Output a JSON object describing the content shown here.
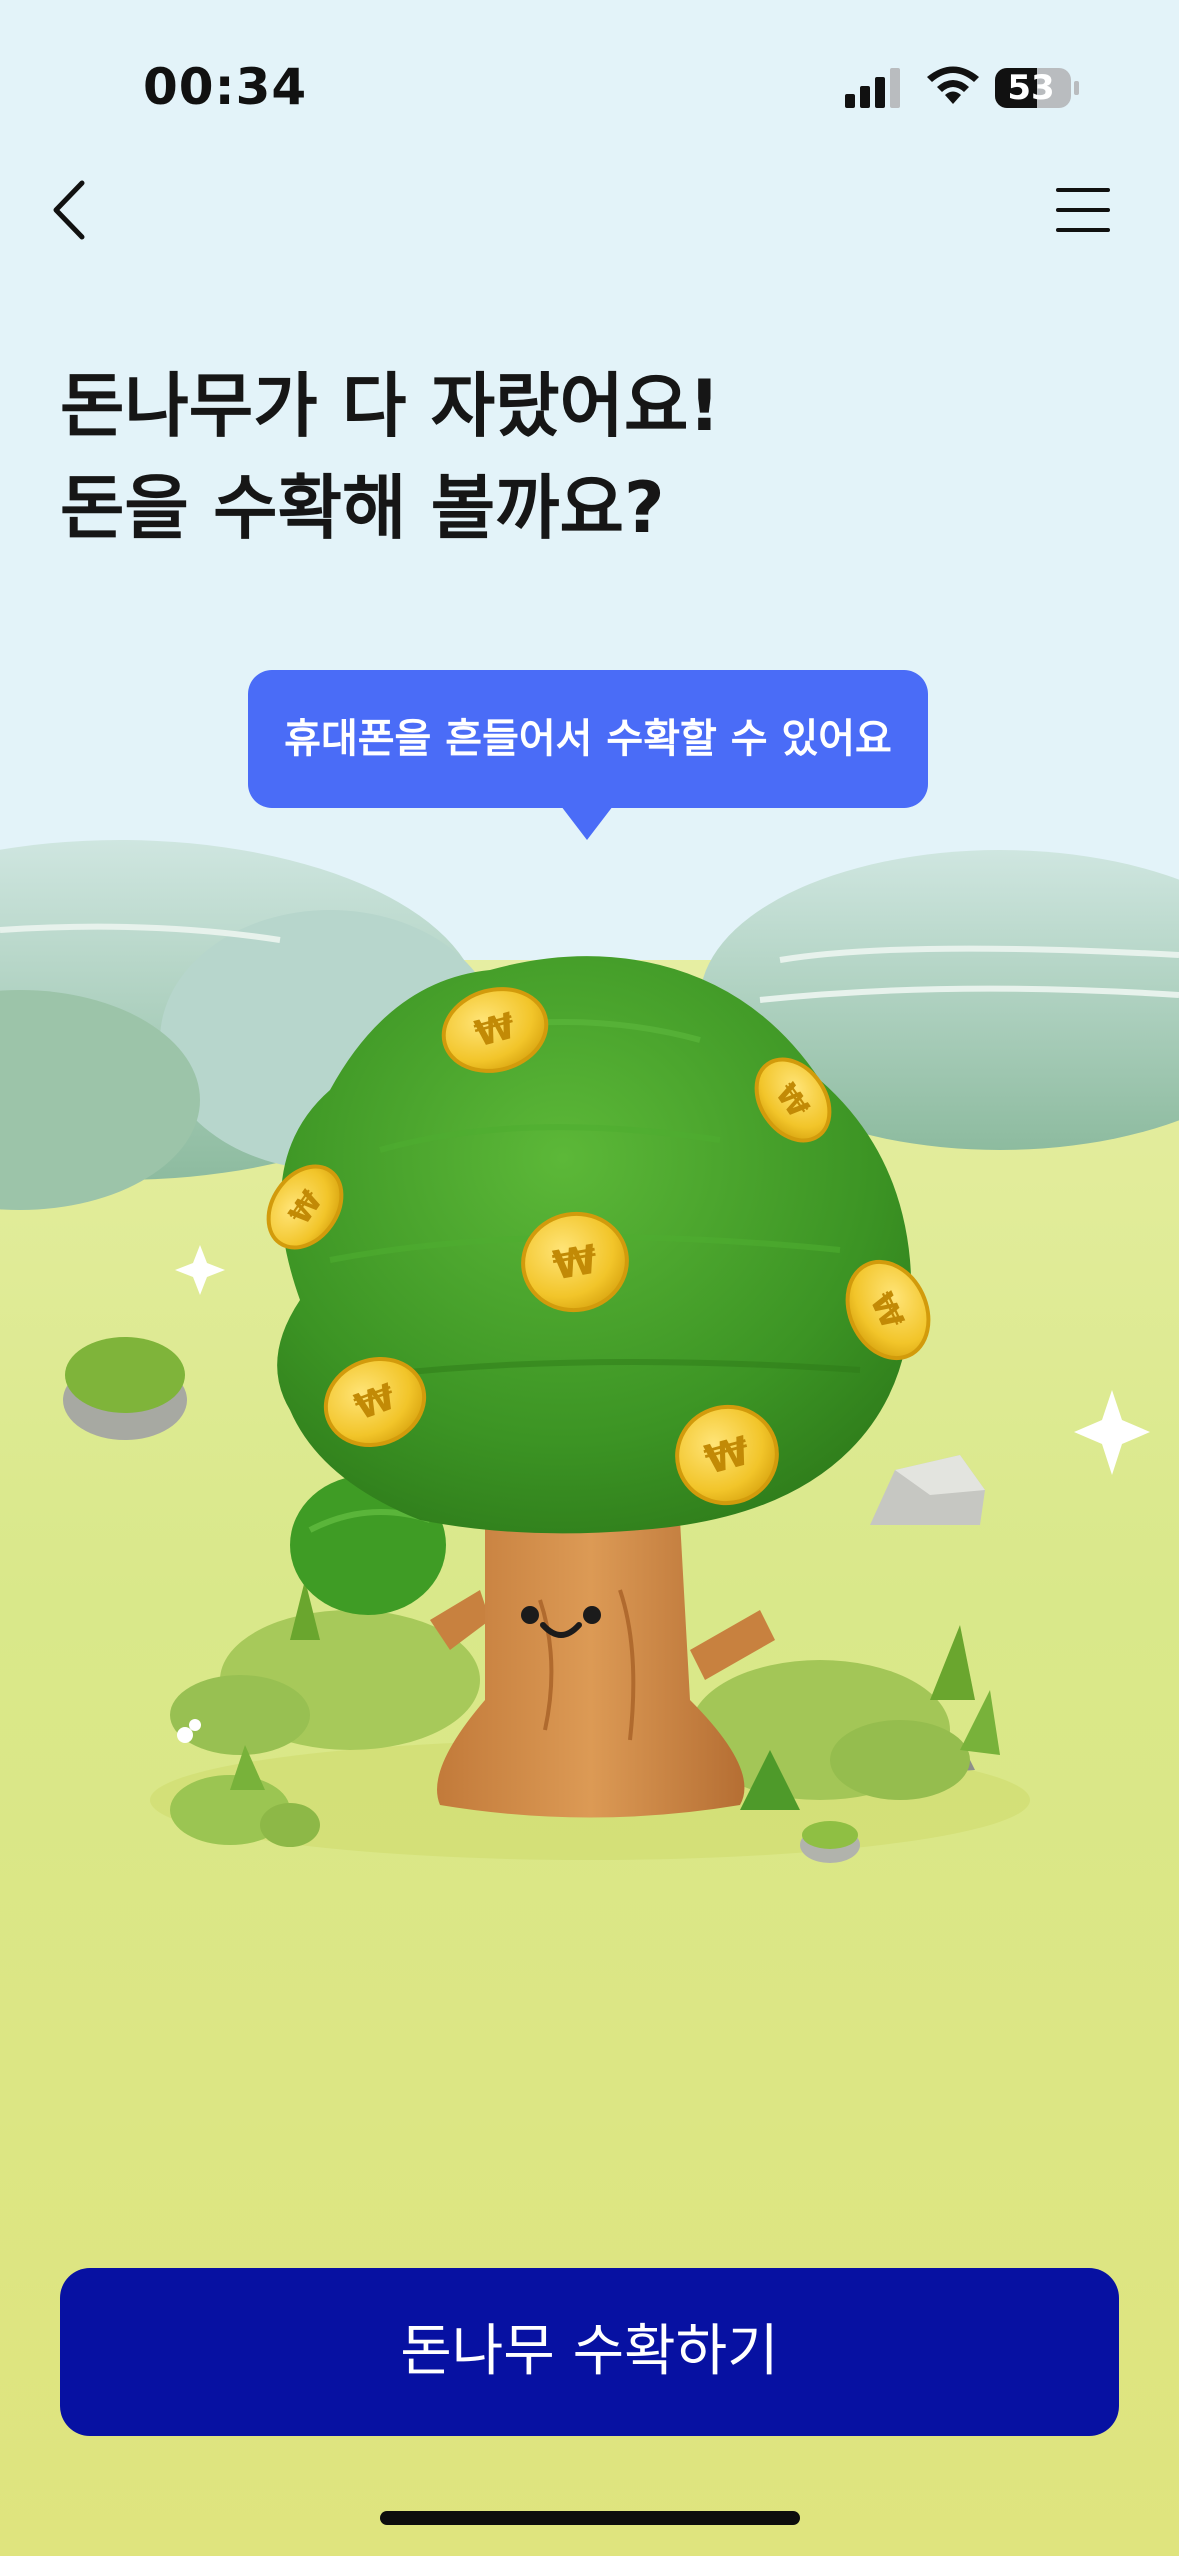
{
  "status_bar": {
    "time": "00:34",
    "battery": "53",
    "icons": [
      "signal-icon",
      "wifi-icon",
      "battery-icon"
    ]
  },
  "nav": {
    "back_icon": "chevron-left-icon",
    "menu_icon": "hamburger-menu-icon"
  },
  "headline": {
    "line1": "돈나무가 다 자랐어요!",
    "line2": "돈을 수확해 볼까요?"
  },
  "tooltip": {
    "text": "휴대폰을 흔들어서 수확할 수 있어요"
  },
  "illustration": {
    "subject": "money-tree-with-coins",
    "coin_symbol": "₩"
  },
  "cta": {
    "label": "돈나무 수확하기"
  },
  "colors": {
    "sky": "#e3f3f9",
    "grass": "#dfe682",
    "tooltip": "#4a6cf7",
    "cta": "#0711a2",
    "tree_canopy": "#3f9c25",
    "coin": "#f0c62e"
  }
}
